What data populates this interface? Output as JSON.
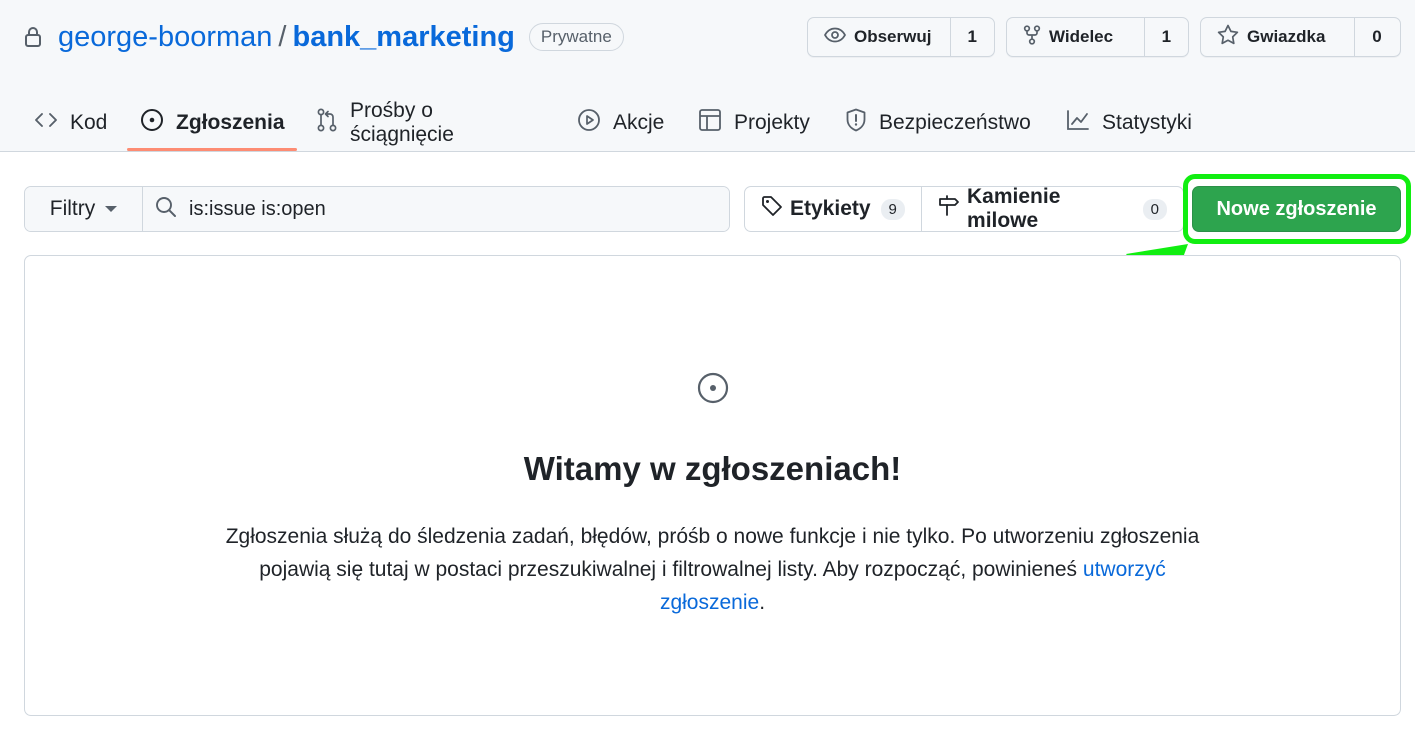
{
  "repo": {
    "owner": "george-boorman",
    "separator": "/",
    "name": "bank_marketing",
    "visibility": "Prywatne"
  },
  "actions": {
    "watch": {
      "label": "Obserwuj",
      "count": "1"
    },
    "fork": {
      "label": "Widelec",
      "count": "1"
    },
    "star": {
      "label": "Gwiazdka",
      "count": "0"
    }
  },
  "tabs": [
    {
      "label": "Kod",
      "icon": "code-icon"
    },
    {
      "label": "Zgłoszenia",
      "icon": "issue-opened-icon",
      "active": true
    },
    {
      "label": "Prośby o ściągnięcie",
      "icon": "git-pull-request-icon"
    },
    {
      "label": "Akcje",
      "icon": "play-icon"
    },
    {
      "label": "Projekty",
      "icon": "table-icon"
    },
    {
      "label": "Bezpieczeństwo",
      "icon": "shield-icon"
    },
    {
      "label": "Statystyki",
      "icon": "graph-icon"
    }
  ],
  "toolbar": {
    "filters_label": "Filtry",
    "search_value": "is:issue is:open",
    "labels_label": "Etykiety",
    "labels_count": "9",
    "milestones_label": "Kamienie milowe",
    "milestones_count": "0",
    "new_issue_label": "Nowe zgłoszenie"
  },
  "blankslate": {
    "title": "Witamy w zgłoszeniach!",
    "text_before": "Zgłoszenia służą do śledzenia zadań, błędów, próśb o nowe funkcje i nie tylko. Po utworzeniu zgłoszenia pojawią się tutaj w postaci przeszukiwalnej  i filtrowalnej listy. Aby rozpocząć, powinieneś ",
    "link_text": "utworzyć zgłoszenie",
    "text_after": "."
  },
  "colors": {
    "link": "#0969da",
    "primary_button": "#2da44e",
    "annotation": "#11ee11",
    "active_tab_underline": "#fd8c73"
  }
}
